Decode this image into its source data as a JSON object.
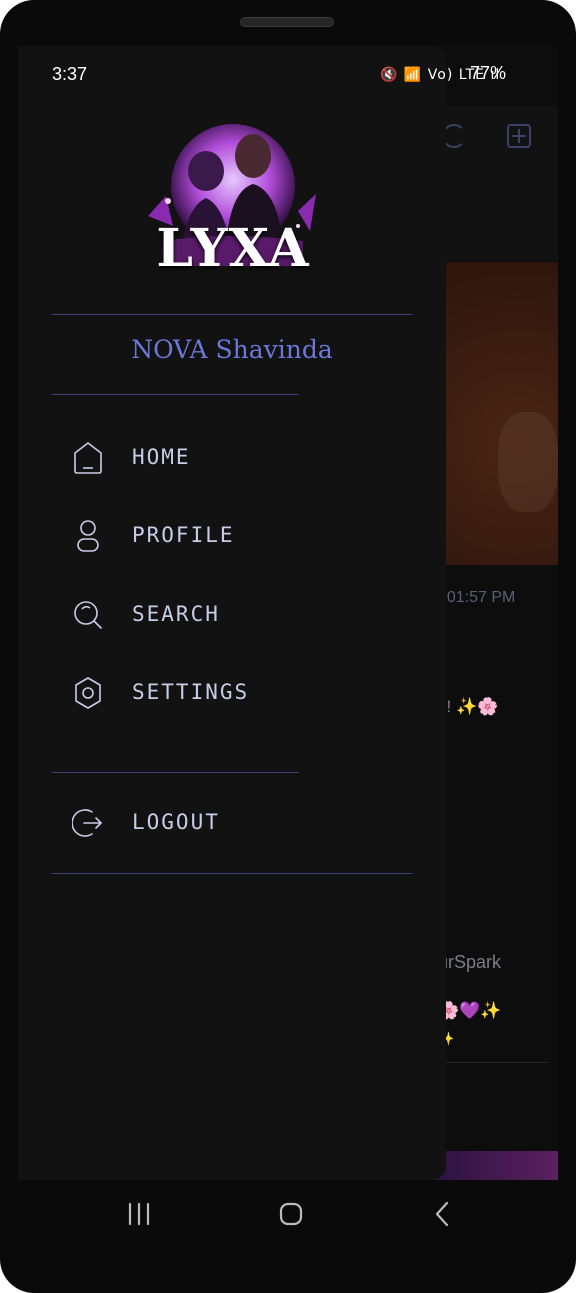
{
  "status_bar": {
    "time": "3:37",
    "indicators": "🔇 📶 Vo) LTE ıl",
    "battery": "77%"
  },
  "drawer": {
    "logo_text": "LYXA",
    "user_name": "NOVA Shavinda",
    "menu": [
      {
        "label": "HOME",
        "icon": "home-icon"
      },
      {
        "label": "PROFILE",
        "icon": "profile-icon"
      },
      {
        "label": "SEARCH",
        "icon": "search-icon"
      },
      {
        "label": "SETTINGS",
        "icon": "settings-icon"
      }
    ],
    "logout_label": "LOGOUT"
  },
  "background_feed": {
    "time_fragment": ", 01:57 PM",
    "caption_fragment": "s! ✨🌸",
    "tag_fragment": "urSpark",
    "emoji_fragment": "🌸💜✨",
    "emoji_fragment_2": "✨"
  },
  "colors": {
    "accent": "#6b78d8",
    "divider": "#3b3f7a",
    "drawer_bg": "#121212",
    "menu_text": "#c8cce8"
  }
}
